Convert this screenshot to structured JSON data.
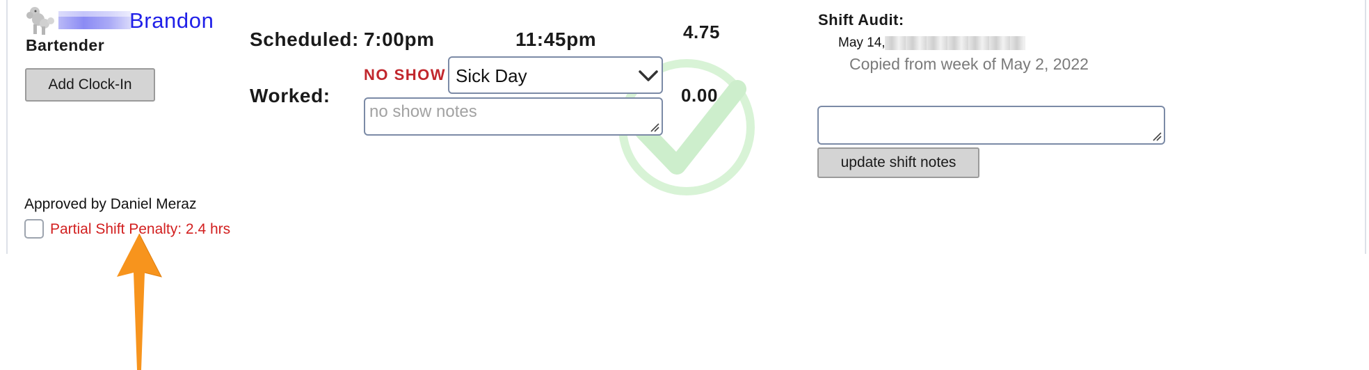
{
  "employee": {
    "avatar_icon": "poodle-avatar-icon",
    "name": "Brandon",
    "role": "Bartender",
    "add_clockin_label": "Add Clock-In"
  },
  "schedule": {
    "scheduled_label": "Scheduled:",
    "start": "7:00pm",
    "end": "11:45pm",
    "scheduled_hours": "4.75",
    "worked_label": "Worked:",
    "worked_hours": "0.00",
    "no_show_label": "NO SHOW",
    "reason_selected": "Sick Day",
    "notes_placeholder": "no show notes",
    "approved_icon": "green-checkmark-icon"
  },
  "audit": {
    "title": "Shift Audit:",
    "date": "May 14,",
    "copied": "Copied from week of May 2, 2022",
    "shift_notes_value": "",
    "update_label": "update shift notes"
  },
  "approval": {
    "approved_by": "Approved by Daniel Meraz",
    "penalty_label": "Partial Shift Penalty: 2.4 hrs",
    "penalty_checked": false
  },
  "annotation": {
    "arrow_icon": "orange-up-arrow-icon",
    "arrow_color": "#f7941d"
  },
  "colors": {
    "name_blue": "#2020e8",
    "no_show_red": "#c1272d",
    "penalty_red": "#d21f1f",
    "check_green": "#cdeecc",
    "input_border": "#7b8aa6",
    "button_bg": "#d4d4d4"
  }
}
